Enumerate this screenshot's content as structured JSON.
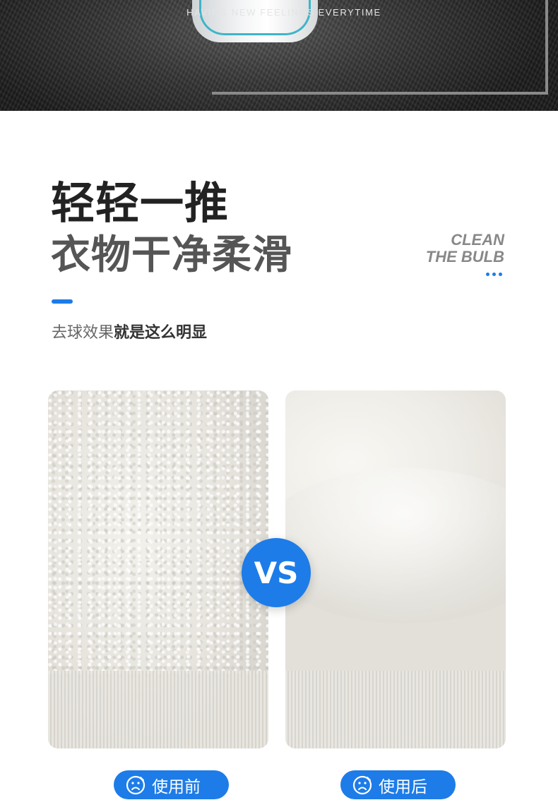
{
  "banner": {
    "tagline": "HAVING NEW FEELINGS EVERYTIME"
  },
  "heading": {
    "line1": "轻轻一推",
    "line2": "衣物干净柔滑",
    "english_line1": "CLEAN",
    "english_line2": "THE BULB"
  },
  "subtitle": {
    "normal": "去球效果",
    "bold": "就是这么明显"
  },
  "comparison": {
    "vs_label": "VS",
    "before_label": "使用前",
    "after_label": "使用后",
    "before_icon": "sad-face-icon",
    "after_icon": "sad-face-icon"
  },
  "colors": {
    "accent": "#1d7ce8",
    "title_dark": "#222222",
    "title_gray": "#555555"
  }
}
